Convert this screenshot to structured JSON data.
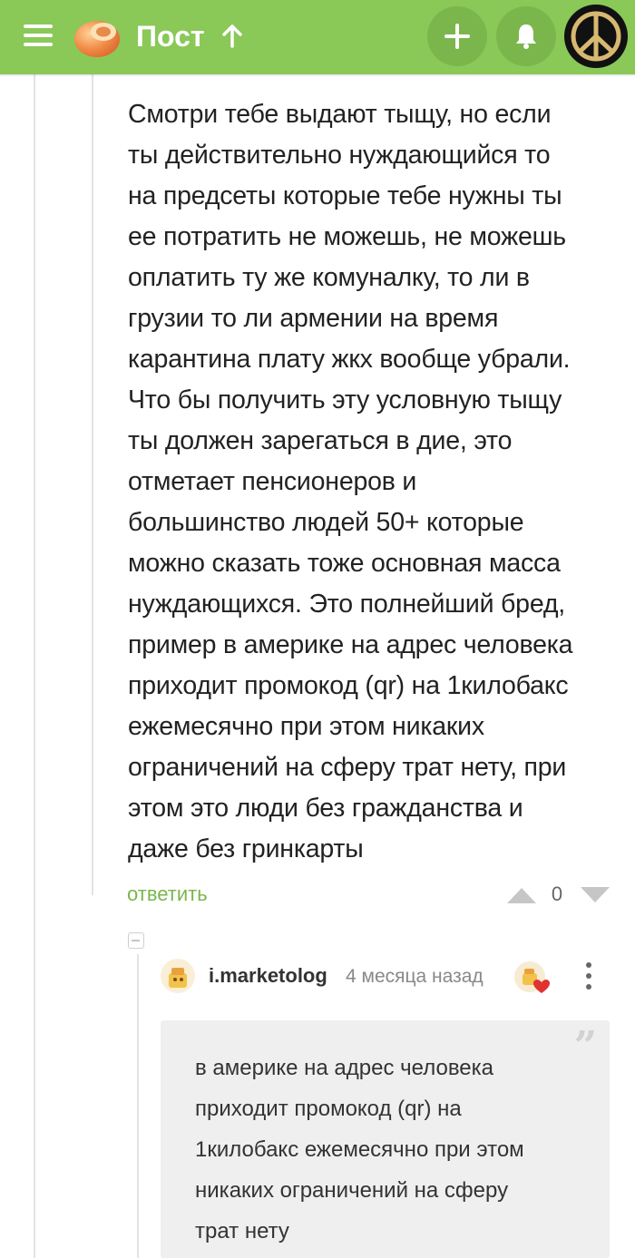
{
  "header": {
    "title": "Пост",
    "icons": {
      "menu": "hamburger-menu-icon",
      "logo": "pikabu-logo",
      "scroll_top": "arrow-up-icon",
      "add": "plus-icon",
      "notifications": "bell-icon",
      "avatar": "peace-sign-avatar"
    },
    "colors": {
      "bar": "#8ac858",
      "button": "#7bb64d"
    }
  },
  "comment": {
    "text": "Смотри тебе выдают тыщу, но если\nты действительно нуждающийся то\nна предсеты которые тебе нужны ты\nее потратить не можешь, не можешь\nоплатить ту же комуналку, то ли в\nгрузии то ли армении на время\nкарантина плату жкх вообще убрали.\nЧто бы получить эту условную тыщу\nты должен зарегаться в дие, это\nотметает пенсионеров и\nбольшинство людей 50+ которые\nможно сказать тоже основная масса\nнуждающихся. Это полнейший бред,\nпример в америке на адрес человека\nприходит промокод (qr) на 1килобакс\nежемесячно при этом никаких\nограничений на сферу трат нету, при\nэтом это люди без гражданства и\nдаже без гринкарты",
    "reply_label": "ответить",
    "rating": "0"
  },
  "reply": {
    "username": "i.marketolog",
    "timestamp": "4 месяца назад",
    "quote_mark": "”",
    "quote": "в америке на адрес человека\nприходит промокод (qr) на\n1килобакс ежемесячно при этом\nникаких ограничений на сферу\nтрат нету"
  }
}
